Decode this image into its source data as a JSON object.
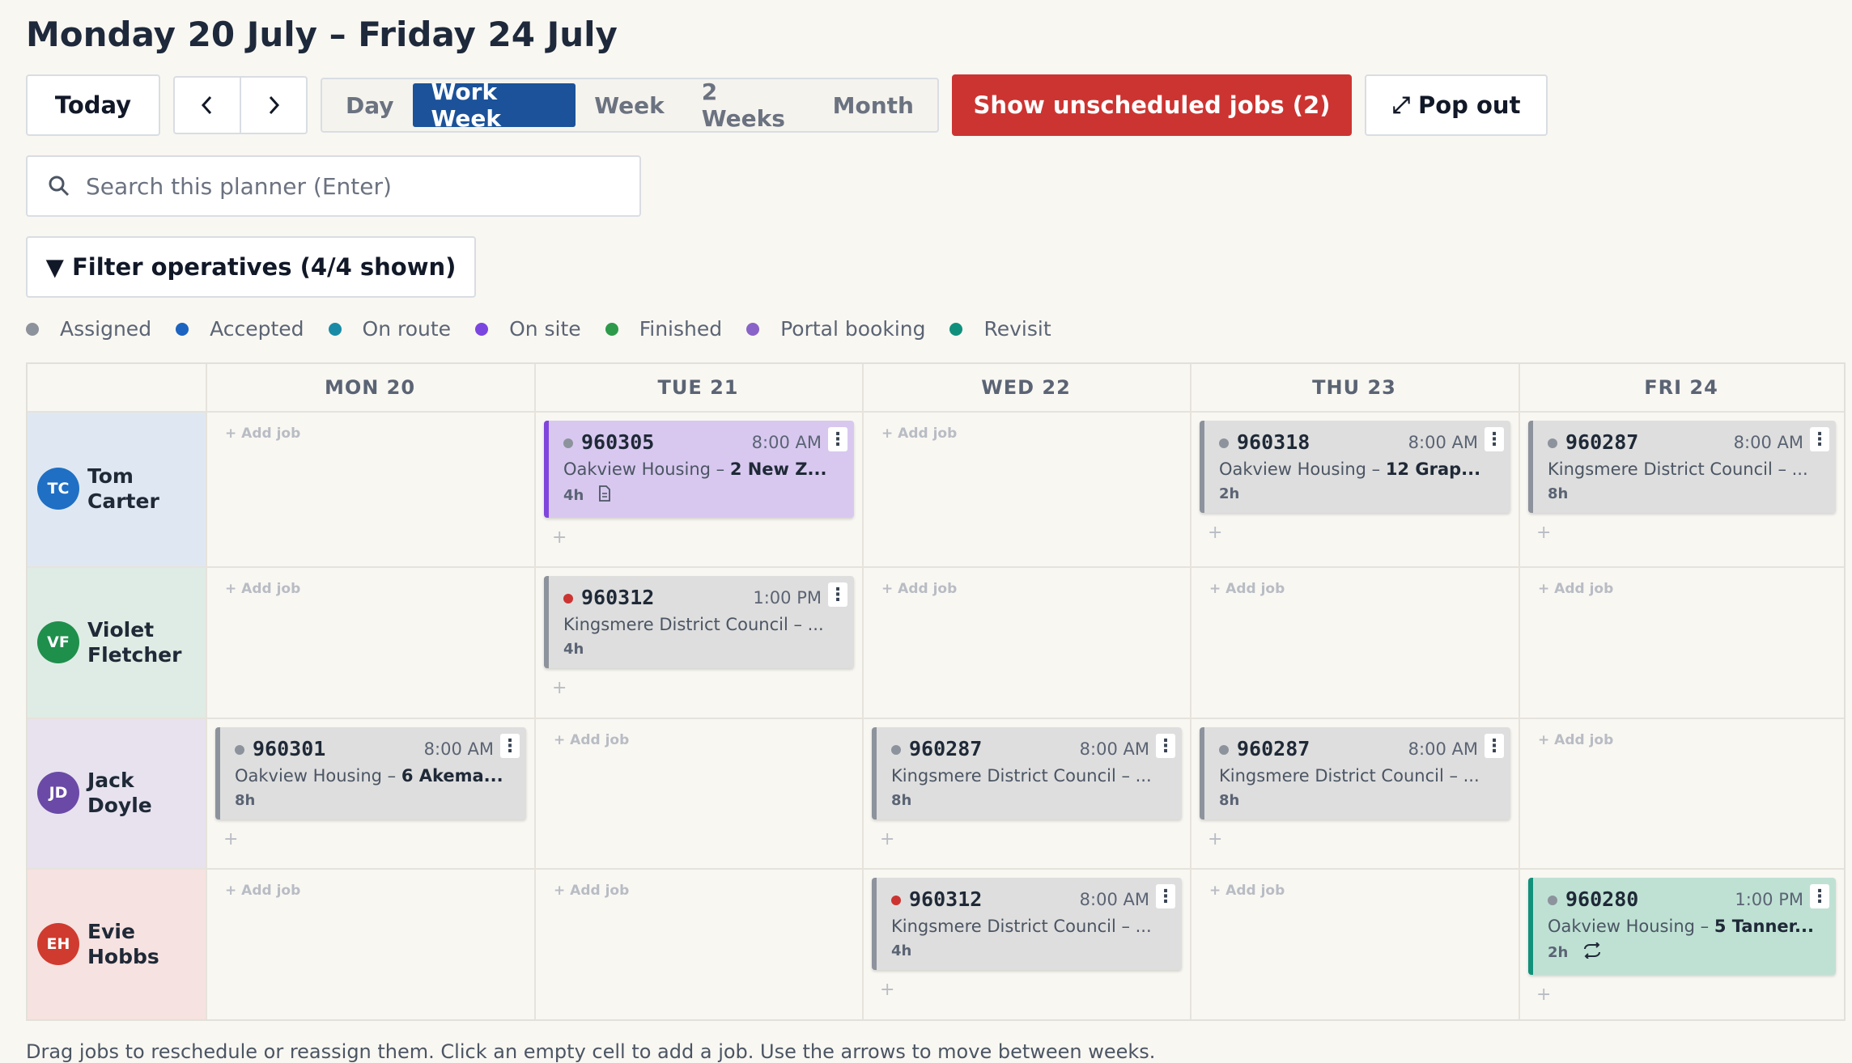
{
  "header": {
    "title": "Monday 20 July – Friday 24 July"
  },
  "toolbar": {
    "today": "Today",
    "prev_icon": "‹",
    "next_icon": "›",
    "views": [
      "Day",
      "Work Week",
      "Week",
      "2 Weeks",
      "Month"
    ],
    "active_view": "Work Week",
    "unscheduled": "Show unscheduled jobs (2)",
    "popout_icon": "⤢",
    "popout": "Pop out"
  },
  "search": {
    "placeholder": "Search this planner (Enter)",
    "value": ""
  },
  "filter": {
    "label": "▼ Filter operatives (4/4 shown)"
  },
  "legend": [
    {
      "label": "Assigned",
      "color": "#8d939c"
    },
    {
      "label": "Accepted",
      "color": "#1c64c0"
    },
    {
      "label": "On route",
      "color": "#1a8ba6"
    },
    {
      "label": "On site",
      "color": "#7b46e0"
    },
    {
      "label": "Finished",
      "color": "#2d9a4a"
    },
    {
      "label": "Portal booking",
      "color": "#8a63c8"
    },
    {
      "label": "Revisit",
      "color": "#10907c"
    }
  ],
  "days": [
    "MON 20",
    "TUE 21",
    "WED 22",
    "THU 23",
    "FRI 24"
  ],
  "add_job_label": "+ Add job",
  "operatives": [
    {
      "initials": "TC",
      "first": "Tom",
      "last": "Carter",
      "avatar": "#1f6fc4",
      "row_bg": "#dfe8f2"
    },
    {
      "initials": "VF",
      "first": "Violet",
      "last": "Fletcher",
      "avatar": "#1f8f4c",
      "row_bg": "#dfece5"
    },
    {
      "initials": "JD",
      "first": "Jack",
      "last": "Doyle",
      "avatar": "#6a4aa6",
      "row_bg": "#e8e2ef"
    },
    {
      "initials": "EH",
      "first": "Evie",
      "last": "Hobbs",
      "avatar": "#cf3b2f",
      "row_bg": "#f6e2e0"
    }
  ],
  "jobs": [
    {
      "op": 0,
      "day": 1,
      "number": "960305",
      "time": "8:00 AM",
      "client": "Oakview Housing – ",
      "address": "2 New Z...",
      "duration": "4h",
      "style": "purple",
      "dot": "#8d939c",
      "extra_icon": "document"
    },
    {
      "op": 0,
      "day": 3,
      "number": "960318",
      "time": "8:00 AM",
      "client": "Oakview Housing – ",
      "address": "12 Grap...",
      "duration": "2h",
      "style": "grey",
      "dot": "#8d939c"
    },
    {
      "op": 0,
      "day": 4,
      "number": "960287",
      "time": "8:00 AM",
      "client": "Kingsmere District Council – ...",
      "address": "",
      "duration": "8h",
      "style": "grey",
      "dot": "#8d939c"
    },
    {
      "op": 1,
      "day": 1,
      "number": "960312",
      "time": "1:00 PM",
      "client": "Kingsmere District Council – ...",
      "address": "",
      "duration": "4h",
      "style": "grey",
      "dot": "#cc3431"
    },
    {
      "op": 2,
      "day": 0,
      "number": "960301",
      "time": "8:00 AM",
      "client": "Oakview Housing – ",
      "address": "6 Akema...",
      "duration": "8h",
      "style": "grey",
      "dot": "#8d939c"
    },
    {
      "op": 2,
      "day": 2,
      "number": "960287",
      "time": "8:00 AM",
      "client": "Kingsmere District Council – ...",
      "address": "",
      "duration": "8h",
      "style": "grey",
      "dot": "#8d939c"
    },
    {
      "op": 2,
      "day": 3,
      "number": "960287",
      "time": "8:00 AM",
      "client": "Kingsmere District Council – ...",
      "address": "",
      "duration": "8h",
      "style": "grey",
      "dot": "#8d939c"
    },
    {
      "op": 3,
      "day": 2,
      "number": "960312",
      "time": "8:00 AM",
      "client": "Kingsmere District Council – ...",
      "address": "",
      "duration": "4h",
      "style": "grey",
      "dot": "#cc3431"
    },
    {
      "op": 3,
      "day": 4,
      "number": "960280",
      "time": "1:00 PM",
      "client": "Oakview Housing – ",
      "address": "5 Tanner...",
      "duration": "2h",
      "style": "teal",
      "dot": "#8d939c",
      "extra_icon": "repeat"
    }
  ],
  "footer": {
    "text": "Drag jobs to reschedule or reassign them. Click an empty cell to add a job. Use the arrows to move between weeks."
  }
}
